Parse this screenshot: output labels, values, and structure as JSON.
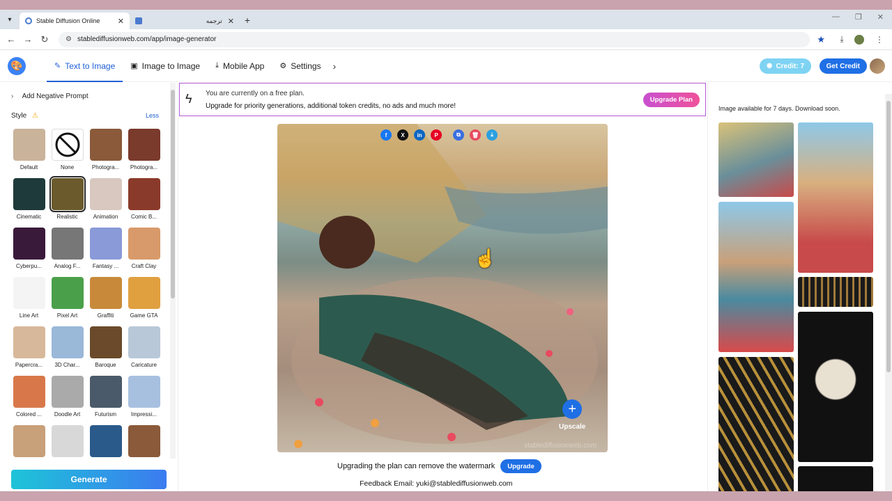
{
  "browser": {
    "tabs": [
      {
        "title": "Stable Diffusion Online",
        "active": true
      },
      {
        "title": "ترجمه",
        "active": false
      }
    ],
    "url": "stablediffusionweb.com/app/image-generator"
  },
  "header": {
    "nav": [
      {
        "label": "Text to Image",
        "icon": "wand-icon",
        "active": true
      },
      {
        "label": "Image to Image",
        "icon": "image-icon",
        "active": false
      },
      {
        "label": "Mobile App",
        "icon": "download-icon",
        "active": false
      },
      {
        "label": "Settings",
        "icon": "gear-icon",
        "active": false
      }
    ],
    "credit_label": "Credit: 7",
    "get_credit_label": "Get Credit"
  },
  "left": {
    "negative_prompt_label": "Add Negative Prompt",
    "style_label": "Style",
    "less_label": "Less",
    "generate_label": "Generate",
    "styles": [
      {
        "label": "Default",
        "color": "#c9b39a"
      },
      {
        "label": "None",
        "color": "#ffffff"
      },
      {
        "label": "Photogra...",
        "color": "#8a5a3a"
      },
      {
        "label": "Photogra...",
        "color": "#7a3a2c"
      },
      {
        "label": "Cinematic",
        "color": "#1f3a3a"
      },
      {
        "label": "Realistic",
        "color": "#6a5a2c",
        "selected": true
      },
      {
        "label": "Animation",
        "color": "#d8c8c0"
      },
      {
        "label": "Comic B...",
        "color": "#8a3a2a"
      },
      {
        "label": "Cyberpu...",
        "color": "#3a1a3a"
      },
      {
        "label": "Analog F...",
        "color": "#777777"
      },
      {
        "label": "Fantasy ...",
        "color": "#8a9ad8"
      },
      {
        "label": "Craft Clay",
        "color": "#d89a6a"
      },
      {
        "label": "Line Art",
        "color": "#f4f4f4"
      },
      {
        "label": "Pixel Art",
        "color": "#4aa04a"
      },
      {
        "label": "Graffiti",
        "color": "#c88a3a"
      },
      {
        "label": "Game GTA",
        "color": "#e0a040"
      },
      {
        "label": "Papercra...",
        "color": "#d8b89a"
      },
      {
        "label": "3D Char...",
        "color": "#9ab8d8"
      },
      {
        "label": "Baroque",
        "color": "#6a4a2a"
      },
      {
        "label": "Caricature",
        "color": "#b8c8d8"
      },
      {
        "label": "Colored ...",
        "color": "#d8784a"
      },
      {
        "label": "Doodle Art",
        "color": "#aaaaaa"
      },
      {
        "label": "Futurism",
        "color": "#4a5a6a"
      },
      {
        "label": "Impressi...",
        "color": "#a8c0e0"
      },
      {
        "label": "",
        "color": "#c8a07a"
      },
      {
        "label": "",
        "color": "#d8d8d8"
      },
      {
        "label": "",
        "color": "#2a5a8a"
      },
      {
        "label": "",
        "color": "#8a5a3a"
      }
    ]
  },
  "banner": {
    "line1": "You are currently on a free plan.",
    "line2": "Upgrade for priority generations, additional token credits, no ads and much more!",
    "button": "Upgrade Plan"
  },
  "image": {
    "share_icons": [
      "facebook-icon",
      "x-icon",
      "linkedin-icon",
      "pinterest-icon",
      "copy-icon",
      "delete-icon",
      "download-icon"
    ],
    "upscale_label": "Upscale",
    "watermark": "stablediffusionweb.com"
  },
  "footer": {
    "watermark_text": "Upgrading the plan can remove the watermark",
    "upgrade_label": "Upgrade",
    "feedback": "Feedback Email: yuki@stablediffusionweb.com"
  },
  "right": {
    "note": "Image available for 7 days. Download soon."
  }
}
